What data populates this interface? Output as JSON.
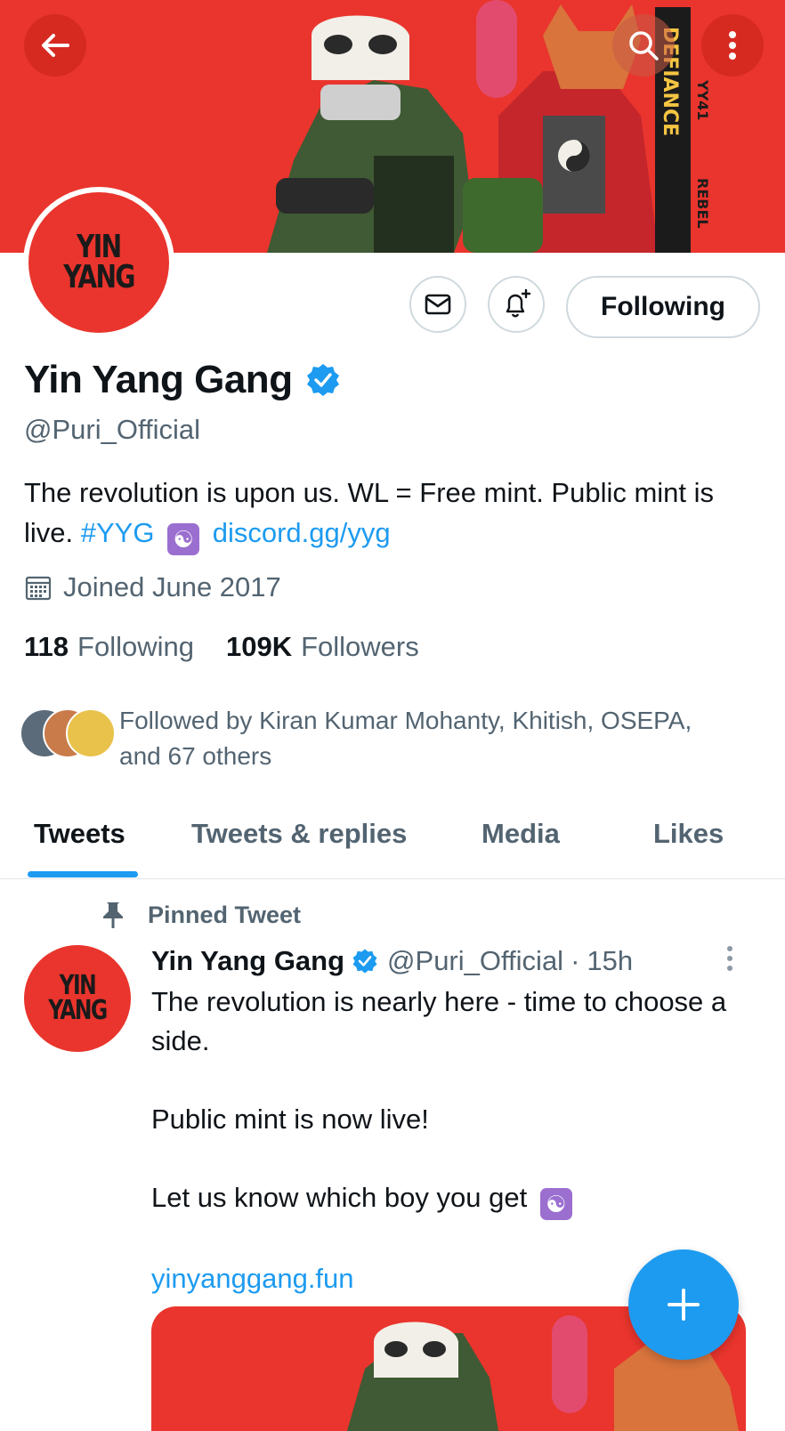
{
  "header": {
    "banner_texts": [
      "DEFIANCE",
      "REBEL",
      "YY41"
    ]
  },
  "profile": {
    "logo_lines": [
      "YIN",
      "YANG"
    ],
    "name": "Yin Yang Gang",
    "handle": "@Puri_Official",
    "bio_text": "The revolution is upon us. WL = Free mint. Public mint is live.",
    "bio_hashtag": "#YYG",
    "bio_link": "discord.gg/yyg",
    "joined": "Joined June 2017",
    "following_count": "118",
    "following_label": "Following",
    "followers_count": "109K",
    "followers_label": "Followers",
    "followed_by": "Followed by Kiran Kumar Mohanty, Khitish, OSEPA, and 67 others"
  },
  "actions": {
    "following_button": "Following"
  },
  "tabs": [
    {
      "label": "Tweets"
    },
    {
      "label": "Tweets & replies"
    },
    {
      "label": "Media"
    },
    {
      "label": "Likes"
    }
  ],
  "pinned_tweet": {
    "pinned_label": "Pinned Tweet",
    "author_name": "Yin Yang Gang",
    "author_handle": "@Puri_Official",
    "separator": "·",
    "time": "15h",
    "line1": "The revolution is nearly here - time to choose a side.",
    "line2": "Public mint is now live!",
    "line3": "Let us know which boy you get",
    "link": "yinyanggang.fun"
  },
  "colors": {
    "brand_red": "#e9352d",
    "accent_blue": "#1d9bf0",
    "secondary_text": "#536471"
  },
  "icons": {
    "back": "arrow-left-icon",
    "search": "search-icon",
    "more": "more-vertical-icon",
    "message": "envelope-icon",
    "notify": "bell-plus-icon",
    "verified": "verified-badge-icon",
    "calendar": "calendar-icon",
    "pin": "pin-icon",
    "compose": "plus-icon"
  }
}
